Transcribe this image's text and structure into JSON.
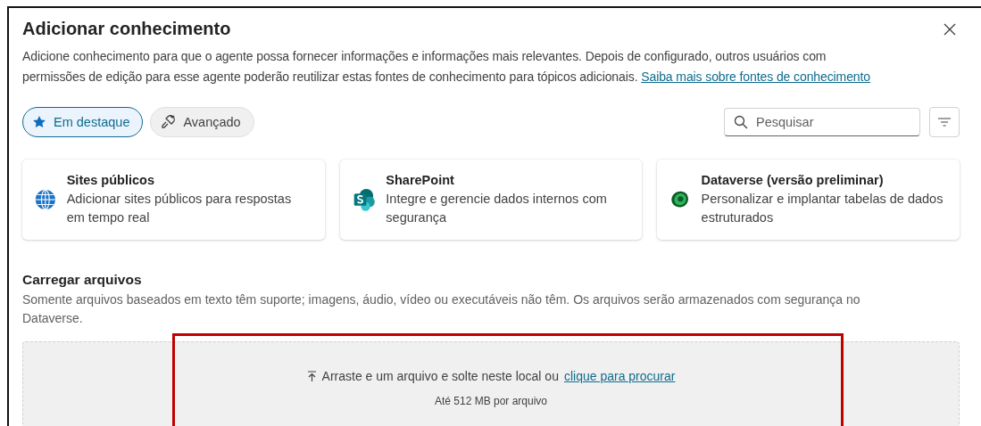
{
  "dialog": {
    "title": "Adicionar conhecimento",
    "description": "Adicione conhecimento para que o agente possa fornecer informações e informações mais relevantes. Depois de configurado, outros usuários com permissões de edição para esse agente poderão reutilizar estas fontes de conhecimento para tópicos adicionais.",
    "learn_more_link": "Saiba mais sobre fontes de conhecimento"
  },
  "tabs": [
    {
      "kind": "star",
      "label": "Em destaque",
      "selected": true
    },
    {
      "kind": "plug",
      "label": "Avançado",
      "selected": false
    }
  ],
  "search": {
    "placeholder": "Pesquisar"
  },
  "sources": [
    {
      "kind": "globe",
      "title": "Sites públicos",
      "description": "Adicionar sites públicos para respostas em tempo real"
    },
    {
      "kind": "sharepoint",
      "title": "SharePoint",
      "description": "Integre e gerencie dados internos com segurança"
    },
    {
      "kind": "dataverse",
      "title": "Dataverse (versão preliminar)",
      "description": "Personalizar e implantar tabelas de dados estruturados"
    }
  ],
  "upload": {
    "title": "Carregar arquivos",
    "description": "Somente arquivos baseados em texto têm suporte; imagens, áudio, vídeo ou executáveis não têm. Os arquivos serão armazenados com segurança no Dataverse.",
    "drop_text": "Arraste e um arquivo e solte neste local ou",
    "browse_link": "clique para procurar",
    "size_limit": "Até 512 MB por arquivo"
  }
}
